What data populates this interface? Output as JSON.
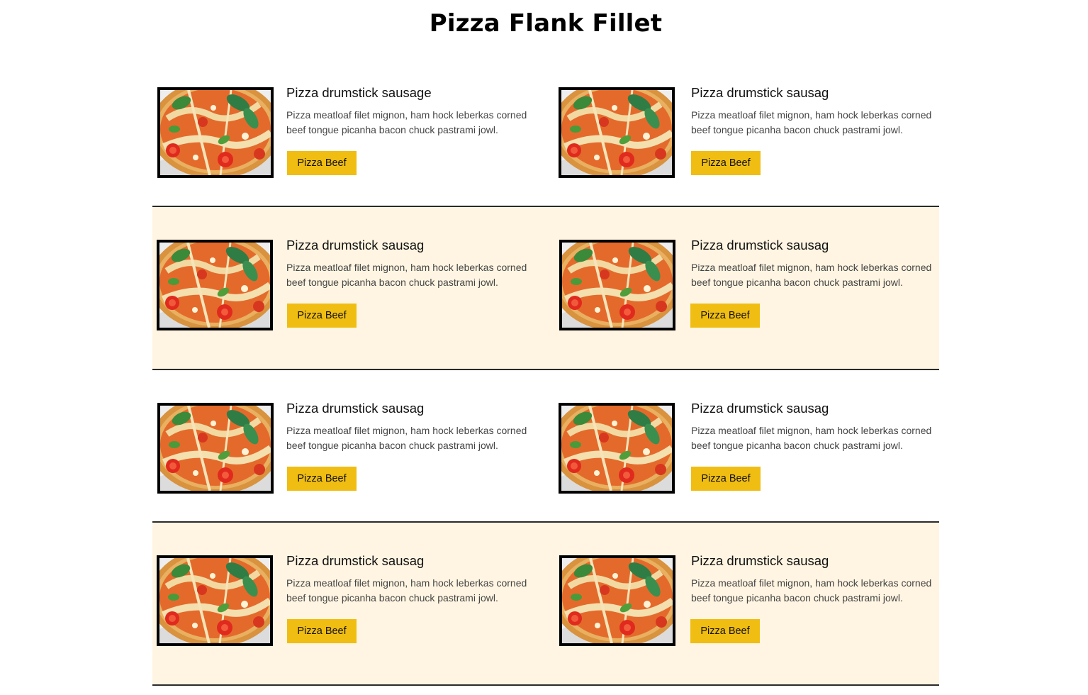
{
  "title": "Pizza Flank Fillet",
  "colors": {
    "accent_button": "#f0bd12",
    "band_tint": "#fff5e2",
    "divider": "#2a2a2a"
  },
  "cards": [
    {
      "title": "Pizza drumstick sausage",
      "description": "Pizza meatloaf filet mignon, ham hock leberkas corned beef tongue picanha bacon chuck pastrami jowl.",
      "button": "Pizza Beef",
      "image": "pizza-image"
    },
    {
      "title": "Pizza drumstick sausag",
      "description": "Pizza meatloaf filet mignon, ham hock leberkas corned beef tongue picanha bacon chuck pastrami jowl.",
      "button": "Pizza Beef",
      "image": "pizza-image"
    },
    {
      "title": "Pizza drumstick sausag",
      "description": "Pizza meatloaf filet mignon, ham hock leberkas corned beef tongue picanha bacon chuck pastrami jowl.",
      "button": "Pizza Beef",
      "image": "pizza-image"
    },
    {
      "title": "Pizza drumstick sausag",
      "description": "Pizza meatloaf filet mignon, ham hock leberkas corned beef tongue picanha bacon chuck pastrami jowl.",
      "button": "Pizza Beef",
      "image": "pizza-image"
    },
    {
      "title": "Pizza drumstick sausag",
      "description": "Pizza meatloaf filet mignon, ham hock leberkas corned beef tongue picanha bacon chuck pastrami jowl.",
      "button": "Pizza Beef",
      "image": "pizza-image"
    },
    {
      "title": "Pizza drumstick sausag",
      "description": "Pizza meatloaf filet mignon, ham hock leberkas corned beef tongue picanha bacon chuck pastrami jowl.",
      "button": "Pizza Beef",
      "image": "pizza-image"
    },
    {
      "title": "Pizza drumstick sausag",
      "description": "Pizza meatloaf filet mignon, ham hock leberkas corned beef tongue picanha bacon chuck pastrami jowl.",
      "button": "Pizza Beef",
      "image": "pizza-image"
    },
    {
      "title": "Pizza drumstick sausag",
      "description": "Pizza meatloaf filet mignon, ham hock leberkas corned beef tongue picanha bacon chuck pastrami jowl.",
      "button": "Pizza Beef",
      "image": "pizza-image"
    }
  ]
}
